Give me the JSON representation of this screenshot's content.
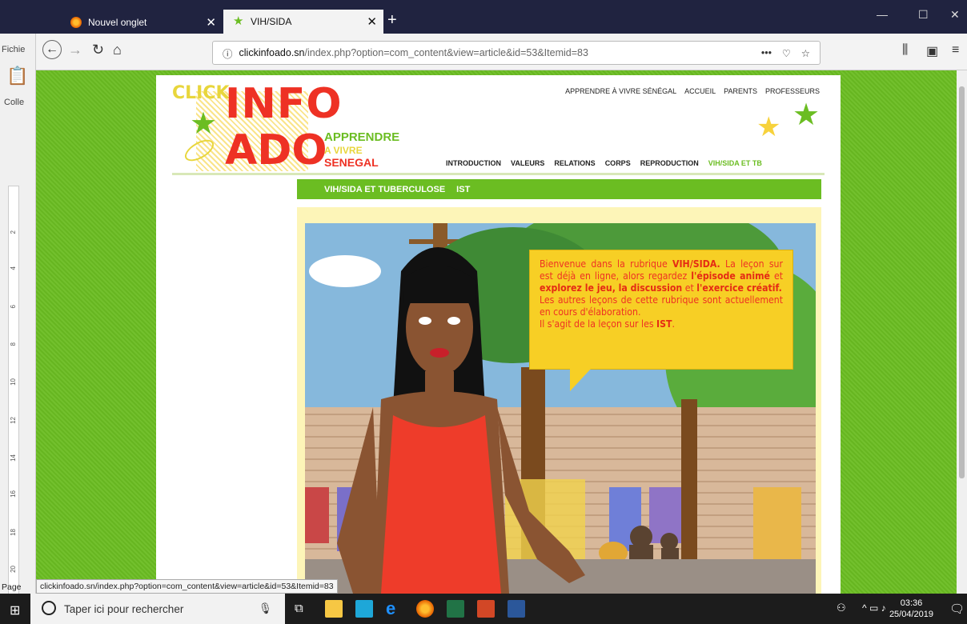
{
  "browser": {
    "tabs": [
      {
        "label": "Nouvel onglet"
      },
      {
        "label": "VIH/SIDA"
      }
    ],
    "url_domain": "clickinfoado.sn",
    "url_path": "/index.php?option=com_content&view=article&id=53&Itemid=83"
  },
  "word": {
    "left_labels": [
      "Fichie",
      "Colle"
    ],
    "page_label": "Page"
  },
  "status_url": "clickinfoado.sn/index.php?option=com_content&view=article&id=53&Itemid=83",
  "site": {
    "logo": {
      "click": "CLICK",
      "info": "INFO",
      "ado": "ADO",
      "line1": "APPRENDRE",
      "line2": "A VIVRE",
      "line3": "SENEGAL"
    },
    "top_nav": [
      "APPRENDRE À VIVRE SÉNÉGAL",
      "ACCUEIL",
      "PARENTS",
      "PROFESSEURS"
    ],
    "main_nav": [
      "INTRODUCTION",
      "VALEURS",
      "RELATIONS",
      "CORPS",
      "REPRODUCTION",
      "VIH/SIDA ET TB"
    ],
    "sub_nav": [
      "VIH/SIDA ET TUBERCULOSE",
      "IST"
    ]
  },
  "bubble": {
    "p1": "Bienvenue dans la rubrique ",
    "b1": "VIH/SIDA.",
    "p2": " La leçon sur est déjà en ligne, alors regardez ",
    "b2": "l'épisode animé",
    "p3": " et ",
    "b3": "explorez  le jeu, la discussion",
    "p4": " et ",
    "b4": "l'exercice créatif.",
    "p5": "Les autres leçons de cette rubrique sont actuellement en cours d'élaboration.",
    "p6": "Il s'agit de la leçon sur les ",
    "b6": "IST",
    "p7": "."
  },
  "taskbar": {
    "search_placeholder": "Taper ici pour rechercher",
    "time": "03:36",
    "date": "25/04/2019"
  }
}
